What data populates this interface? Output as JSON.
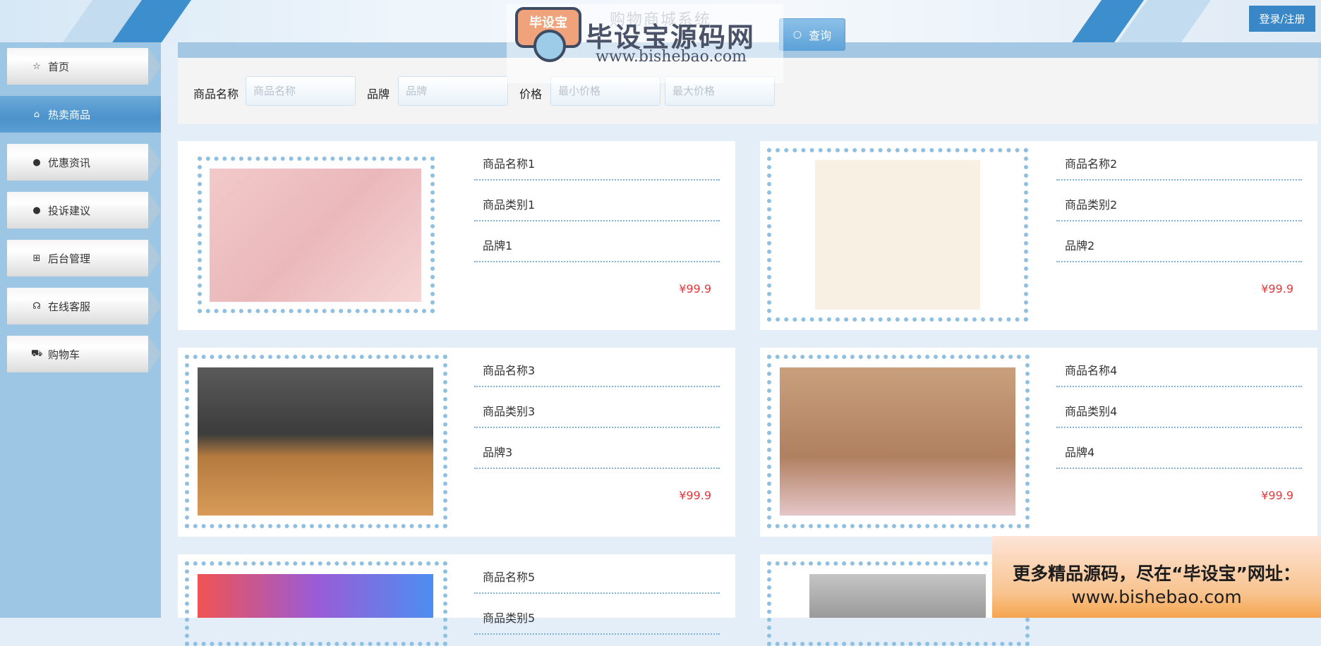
{
  "header": {
    "site_title": "购物商城系统",
    "login_label": "登录/注册"
  },
  "watermark": {
    "badge_text": "毕设宝",
    "brand": "毕设宝源码网",
    "url": "www.bishebao.com"
  },
  "sidebar": {
    "items": [
      {
        "label": "首页",
        "icon": "star-icon",
        "glyph": "☆",
        "active": false
      },
      {
        "label": "热卖商品",
        "icon": "shopping-bag-icon",
        "glyph": "⌂",
        "active": true
      },
      {
        "label": "优惠资讯",
        "icon": "exclamation-circle-icon",
        "glyph": "❗",
        "active": false
      },
      {
        "label": "投诉建议",
        "icon": "question-circle-icon",
        "glyph": "❓",
        "active": false
      },
      {
        "label": "后台管理",
        "icon": "gift-icon",
        "glyph": "⊞",
        "active": false
      },
      {
        "label": "在线客服",
        "icon": "headset-icon",
        "glyph": "☊",
        "active": false
      },
      {
        "label": "购物车",
        "icon": "cart-icon",
        "glyph": "⛟",
        "active": false
      }
    ]
  },
  "search": {
    "name_label": "商品名称",
    "name_placeholder": "商品名称",
    "brand_label": "品牌",
    "brand_placeholder": "品牌",
    "price_label": "价格",
    "min_price_placeholder": "最小价格",
    "max_price_placeholder": "最大价格",
    "button_label": "查询"
  },
  "products": [
    {
      "name": "商品名称1",
      "category": "商品类别1",
      "brand": "品牌1",
      "price": "¥99.9"
    },
    {
      "name": "商品名称2",
      "category": "商品类别2",
      "brand": "品牌2",
      "price": "¥99.9"
    },
    {
      "name": "商品名称3",
      "category": "商品类别3",
      "brand": "品牌3",
      "price": "¥99.9"
    },
    {
      "name": "商品名称4",
      "category": "商品类别4",
      "brand": "品牌4",
      "price": "¥99.9"
    },
    {
      "name": "商品名称5",
      "category": "商品类别5"
    }
  ],
  "promo": {
    "line1": "更多精品源码，尽在“毕设宝”网址：",
    "line2": "www.bishebao.com"
  },
  "colors": {
    "accent": "#3a87c8",
    "sidebar": "#9dc5e4",
    "price": "#e4393c"
  }
}
